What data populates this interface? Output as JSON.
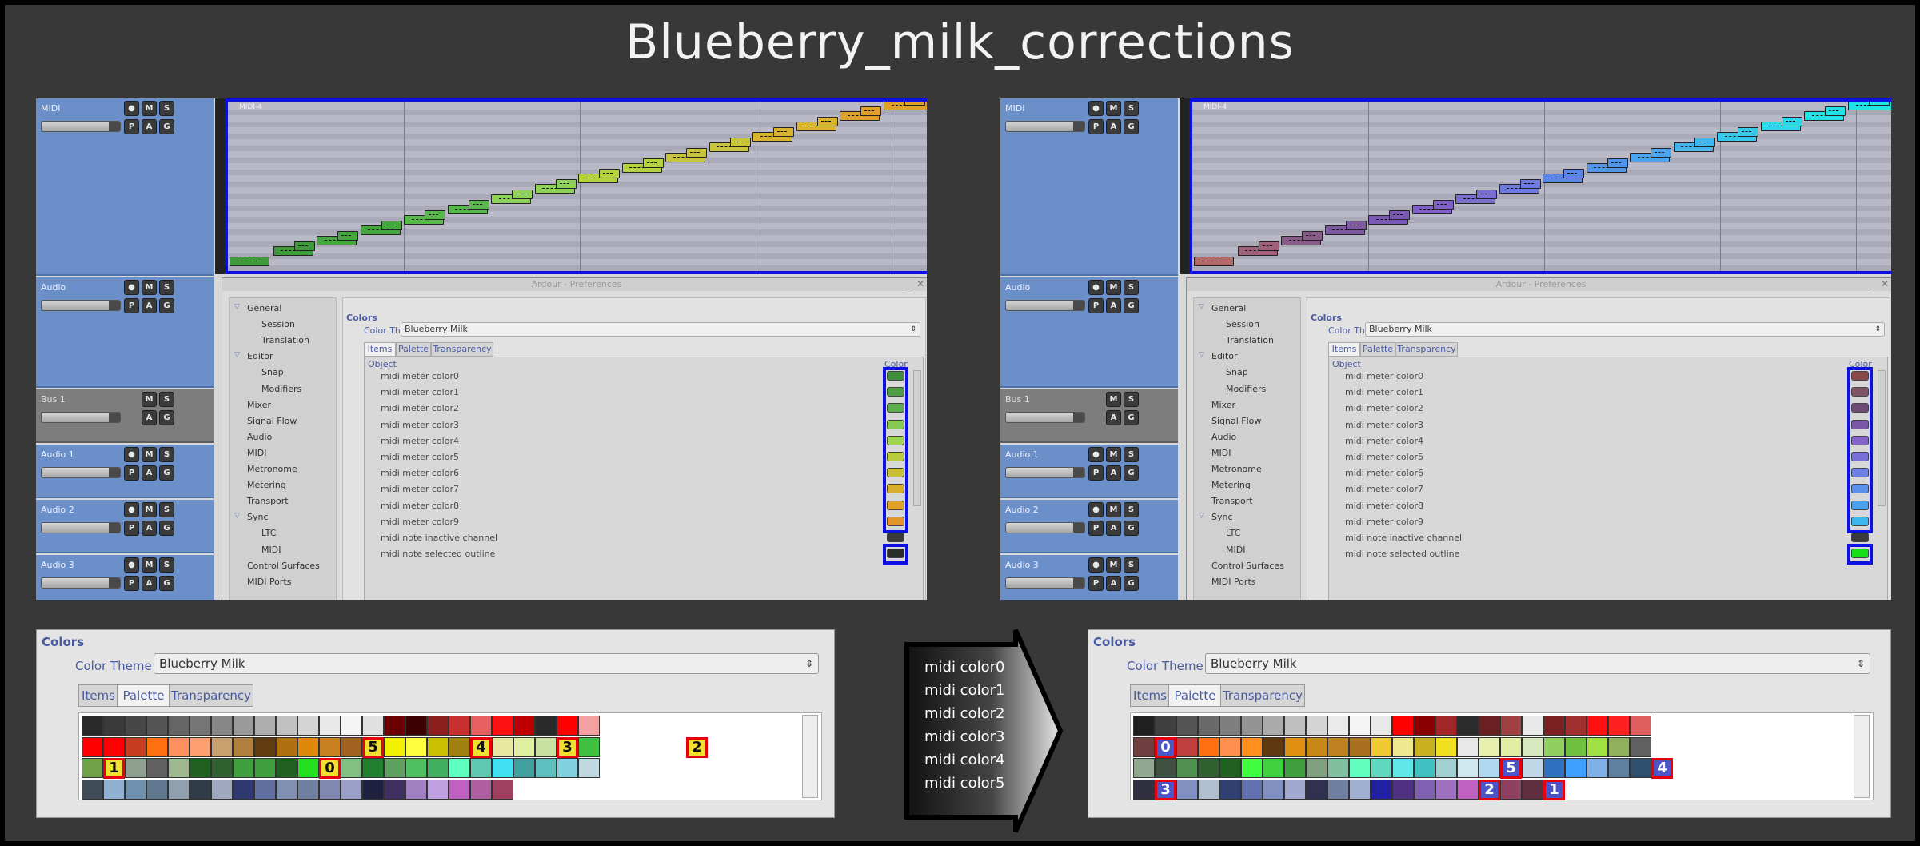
{
  "title": "Blueberry_milk_corrections",
  "tracks": [
    {
      "name": "MIDI",
      "buttons": [
        "M",
        "S",
        "P",
        "A",
        "G"
      ]
    },
    {
      "name": "Audio",
      "buttons": [
        "M",
        "S",
        "P",
        "A",
        "G"
      ]
    },
    {
      "name": "Bus 1",
      "buttons": [
        "M",
        "S",
        "A",
        "G"
      ]
    },
    {
      "name": "Audio 1",
      "buttons": [
        "M",
        "S",
        "P",
        "A",
        "G"
      ]
    },
    {
      "name": "Audio 2",
      "buttons": [
        "M",
        "S",
        "P",
        "A",
        "G"
      ]
    },
    {
      "name": "Audio 3",
      "buttons": [
        "M",
        "S",
        "P",
        "A",
        "G"
      ]
    }
  ],
  "region_label": "MIDI-4",
  "prefs": {
    "window_title": "Ardour - Preferences",
    "tree": [
      {
        "label": "General",
        "level": 0,
        "expanded": true
      },
      {
        "label": "Session",
        "level": 1
      },
      {
        "label": "Translation",
        "level": 1
      },
      {
        "label": "Editor",
        "level": 0,
        "expanded": true
      },
      {
        "label": "Snap",
        "level": 1
      },
      {
        "label": "Modifiers",
        "level": 1
      },
      {
        "label": "Mixer",
        "level": 0
      },
      {
        "label": "Signal Flow",
        "level": 0
      },
      {
        "label": "Audio",
        "level": 0
      },
      {
        "label": "MIDI",
        "level": 0
      },
      {
        "label": "Metronome",
        "level": 0
      },
      {
        "label": "Metering",
        "level": 0
      },
      {
        "label": "Transport",
        "level": 0
      },
      {
        "label": "Sync",
        "level": 0,
        "expanded": true
      },
      {
        "label": "LTC",
        "level": 1
      },
      {
        "label": "MIDI",
        "level": 1
      },
      {
        "label": "Control Surfaces",
        "level": 0
      },
      {
        "label": "MIDI Ports",
        "level": 0
      }
    ],
    "section": "Colors",
    "color_theme_label": "Color Theme",
    "color_theme_value": "Blueberry Milk",
    "tabs": [
      "Items",
      "Palette",
      "Transparency"
    ],
    "col_object": "Object",
    "col_color": "Color",
    "rows": [
      "midi meter color0",
      "midi meter color1",
      "midi meter color2",
      "midi meter color3",
      "midi meter color4",
      "midi meter color5",
      "midi meter color6",
      "midi meter color7",
      "midi meter color8",
      "midi meter color9",
      "midi note inactive channel",
      "midi note selected outline"
    ]
  },
  "before": {
    "note_colors": [
      "#3e9a3a",
      "#3e9a3a",
      "#45a83f",
      "#45a83f",
      "#58b94b",
      "#58b94b",
      "#8fd25a",
      "#8fd25a",
      "#b3d23e",
      "#b3d23e",
      "#c8c43c",
      "#c8c43c",
      "#d9b431",
      "#d9b431",
      "#e0a02a",
      "#e0a02a"
    ],
    "swatches": [
      "#3f8f3a",
      "#4f9e44",
      "#5cad4c",
      "#86c953",
      "#9fd44f",
      "#b9cc3c",
      "#c9bf34",
      "#d6ad2d",
      "#dfa128",
      "#e2962a",
      "#3a3a3a",
      "#2c2c2c"
    ]
  },
  "after": {
    "note_colors": [
      "#b16a6a",
      "#a0607a",
      "#8a5c8a",
      "#7d5aa0",
      "#7a5ab4",
      "#8060c8",
      "#7a6ed2",
      "#6e7ae0",
      "#5a86e6",
      "#4f95ea",
      "#4aa4ee",
      "#43b6ee",
      "#38c8ea",
      "#2fd8e8",
      "#22e2e6",
      "#22e2e6"
    ],
    "swatches": [
      "#8a4848",
      "#7d5566",
      "#6d4c74",
      "#7a58a6",
      "#8464c6",
      "#7a70d8",
      "#6e80e2",
      "#5c90ea",
      "#4aa2ee",
      "#3cb6ee",
      "#3a3a3a",
      "#18e018"
    ]
  },
  "palette_panel": {
    "section": "Colors",
    "color_theme_label": "Color Theme",
    "color_theme_value": "Blueberry Milk",
    "tabs": [
      "Items",
      "Palette",
      "Transparency"
    ]
  },
  "palette_before": [
    [
      "#2a2a2a",
      "#3a3a3a",
      "#474747",
      "#555555",
      "#656565",
      "#757575",
      "#878787",
      "#9a9a9a",
      "#adadad",
      "#c1c1c1",
      "#d4d4d4",
      "#e8e8e8",
      "#f5f5f5",
      "#e0e0e0",
      "#6a0000",
      "#3c0000",
      "#8c2020",
      "#c83030",
      "#e86060",
      "#ff1010",
      "#c00000",
      "#2a2a2a",
      "#ff0000",
      "#f3a0a0"
    ],
    [
      "#ff0000",
      "#ff0000",
      "#c83c20",
      "#ff7010",
      "#ff9060",
      "#ffa070",
      "#c8a070",
      "#b08040",
      "#603c10",
      "#b07010",
      "#e08808",
      "#c88020",
      "#a06020",
      "#704c10",
      "#f0f000",
      "#ffff40",
      "#c8c000",
      "#a08010",
      "#f0f0f0",
      "#e8e8a0",
      "#e0f0a0",
      "#c8e0a0",
      "#a0c880",
      "#40c040"
    ],
    [
      "#70a048",
      "#30c030",
      "#90a090",
      "#606060",
      "#a0b890",
      "#206020",
      "#306030",
      "#40a040",
      "#40a040",
      "#206020",
      "#20e020",
      "#30b030",
      "#80c080",
      "#208030",
      "#60a060",
      "#50c060",
      "#40b060",
      "#60ffc0",
      "#60c8b0",
      "#40e0f0",
      "#40a0a0",
      "#60c0c0",
      "#80d0e0",
      "#c0d8e0"
    ],
    [
      "#404c58",
      "#90b0d0",
      "#7090b0",
      "#607890",
      "#90a0b0",
      "#303c48",
      "#a0a8c0",
      "#303870",
      "#6070a0",
      "#8090b0",
      "#7080a0",
      "#8088b0",
      "#9aa0c8",
      "#202040",
      "#403060",
      "#a080c0",
      "#c0a0e0",
      "#c060c0",
      "#b060a0",
      "#a04060"
    ]
  ],
  "palette_after": [
    [
      "#202020",
      "#404040",
      "#555555",
      "#6a6a6a",
      "#7f7f7f",
      "#949494",
      "#aaaaaa",
      "#bfbfbf",
      "#d4d4d4",
      "#eaeaea",
      "#f5f5f5",
      "#e8e8e8",
      "#ff0000",
      "#8a0000",
      "#a02828",
      "#2c2c2c",
      "#6a2020",
      "#a04040",
      "#e8e8e8",
      "#7a2020",
      "#a03030",
      "#ff1010",
      "#ff2020",
      "#e06060"
    ],
    [
      "#704040",
      "#e0a0a0",
      "#c04040",
      "#ff7010",
      "#ff9050",
      "#ff9020",
      "#603810",
      "#e09010",
      "#c88818",
      "#c08020",
      "#a87020",
      "#f0c830",
      "#f0e890",
      "#c8b020",
      "#f0e020",
      "#e8e8e8",
      "#e8f0b0",
      "#e0f0a0",
      "#d8e8c0",
      "#90d060",
      "#70c040",
      "#a0e040",
      "#90b060",
      "#606060"
    ],
    [
      "#90a890",
      "#405040",
      "#509050",
      "#306030",
      "#206020",
      "#40ff40",
      "#40d040",
      "#40a040",
      "#80a080",
      "#80c0a0",
      "#60ffc0",
      "#60d8c0",
      "#60e8e8",
      "#40c0c0",
      "#a0d0d0",
      "#d0e8f0",
      "#b0d8f0",
      "#e0f0ff",
      "#c0d8e8",
      "#3070c0",
      "#40a0ff",
      "#80b0e8",
      "#6080a0",
      "#305070"
    ],
    [
      "#303040",
      "#5060a0",
      "#8090c0",
      "#b0c0d0",
      "#304070",
      "#6070b0",
      "#8090c0",
      "#a0a8d0",
      "#303050",
      "#7080a0",
      "#a0b0d0",
      "#2020a0",
      "#503080",
      "#8060b0",
      "#a070c0",
      "#c060c0",
      "#c080d0",
      "#904060",
      "#603040",
      "#c04070"
    ]
  ],
  "markers_before": [
    {
      "label": "5",
      "col": 13,
      "row": 1
    },
    {
      "label": "4",
      "col": 18,
      "row": 1
    },
    {
      "label": "3",
      "col": 22,
      "row": 1
    },
    {
      "label": "2",
      "col": 28,
      "row": 1
    },
    {
      "label": "1",
      "col": 1,
      "row": 2
    },
    {
      "label": "0",
      "col": 11,
      "row": 2
    }
  ],
  "markers_after": [
    {
      "label": "0",
      "col": 1,
      "row": 1
    },
    {
      "label": "5",
      "col": 17,
      "row": 2
    },
    {
      "label": "4",
      "col": 24,
      "row": 2
    },
    {
      "label": "3",
      "col": 1,
      "row": 3
    },
    {
      "label": "2",
      "col": 16,
      "row": 3
    },
    {
      "label": "1",
      "col": 19,
      "row": 3
    }
  ],
  "arrow_lines": [
    "midi color0",
    "midi color1",
    "midi color2",
    "midi color3",
    "midi color4",
    "midi color5"
  ],
  "colors": {
    "highlight_blue": "#0c10e0",
    "marker_red": "#e8000c"
  }
}
